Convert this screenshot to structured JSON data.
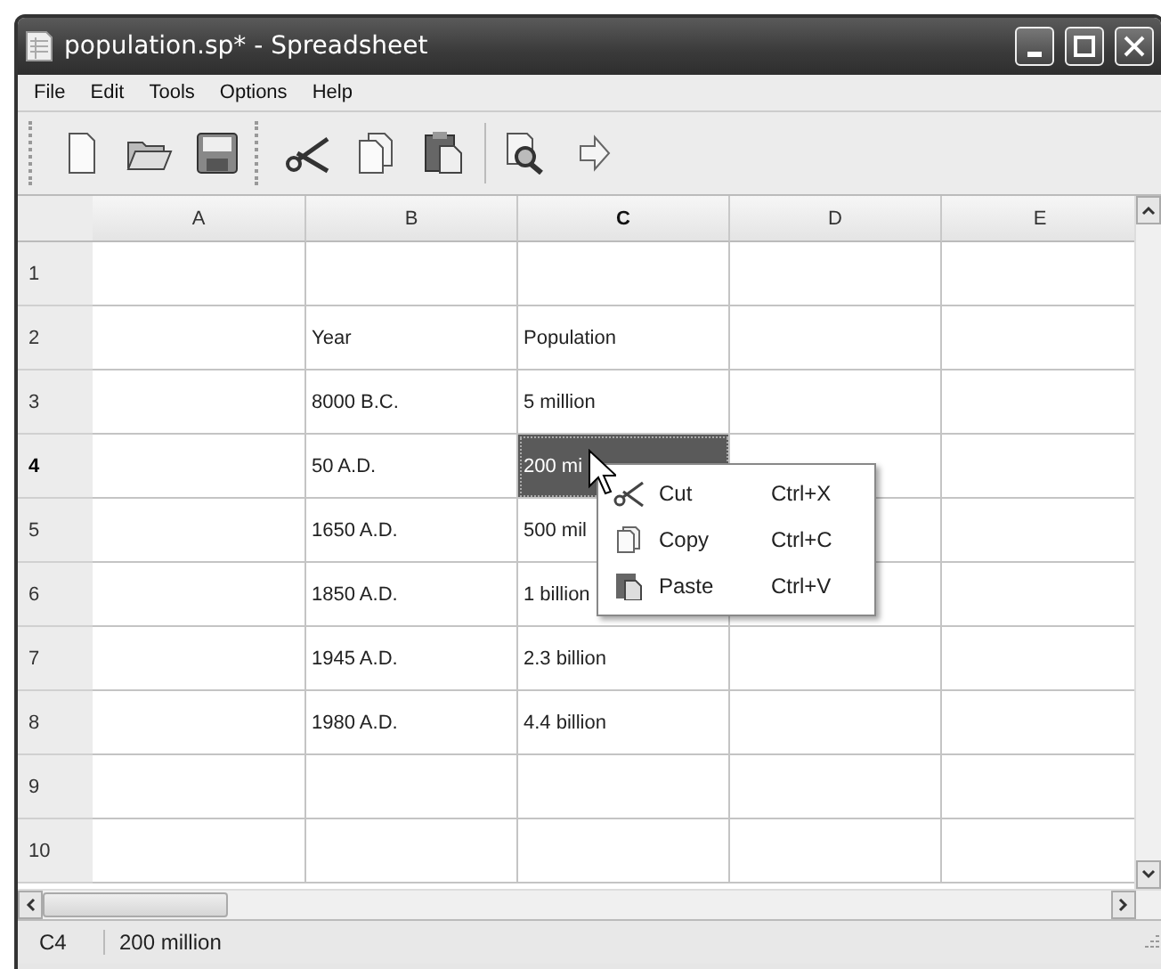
{
  "window": {
    "title": "population.sp* - Spreadsheet"
  },
  "menu_bar": [
    "File",
    "Edit",
    "Tools",
    "Options",
    "Help"
  ],
  "sheet": {
    "columns": [
      {
        "label": "A",
        "selected": false
      },
      {
        "label": "B",
        "selected": false
      },
      {
        "label": "C",
        "selected": true
      },
      {
        "label": "D",
        "selected": false
      },
      {
        "label": "E",
        "selected": false
      }
    ],
    "rows": [
      {
        "header": "1",
        "selected": false,
        "cells": [
          null,
          null,
          null,
          null,
          null
        ]
      },
      {
        "header": "2",
        "selected": false,
        "cells": [
          null,
          {
            "text": "Year",
            "selected": false
          },
          {
            "text": "Population",
            "selected": false
          },
          null,
          null
        ]
      },
      {
        "header": "3",
        "selected": false,
        "cells": [
          null,
          {
            "text": "8000 B.C.",
            "selected": false
          },
          {
            "text": "5 million",
            "selected": false
          },
          null,
          null
        ]
      },
      {
        "header": "4",
        "selected": true,
        "cells": [
          null,
          {
            "text": "50 A.D.",
            "selected": false
          },
          {
            "text": "200 mi",
            "selected": true
          },
          null,
          null
        ]
      },
      {
        "header": "5",
        "selected": false,
        "cells": [
          null,
          {
            "text": "1650 A.D.",
            "selected": false
          },
          {
            "text": "500 mil",
            "selected": false
          },
          null,
          null
        ]
      },
      {
        "header": "6",
        "selected": false,
        "cells": [
          null,
          {
            "text": "1850 A.D.",
            "selected": false
          },
          {
            "text": "1 billion",
            "selected": false
          },
          null,
          null
        ]
      },
      {
        "header": "7",
        "selected": false,
        "cells": [
          null,
          {
            "text": "1945 A.D.",
            "selected": false
          },
          {
            "text": "2.3 billion",
            "selected": false
          },
          null,
          null
        ]
      },
      {
        "header": "8",
        "selected": false,
        "cells": [
          null,
          {
            "text": "1980 A.D.",
            "selected": false
          },
          {
            "text": "4.4 billion",
            "selected": false
          },
          null,
          null
        ]
      },
      {
        "header": "9",
        "selected": false,
        "cells": [
          null,
          null,
          null,
          null,
          null
        ]
      },
      {
        "header": "10",
        "selected": false,
        "cells": [
          null,
          null,
          null,
          null,
          null
        ]
      }
    ]
  },
  "context_menu": [
    {
      "kind": "cut",
      "label": "Cut",
      "shortcut": "Ctrl+X"
    },
    {
      "kind": "copy",
      "label": "Copy",
      "shortcut": "Ctrl+C"
    },
    {
      "kind": "paste",
      "label": "Paste",
      "shortcut": "Ctrl+V"
    }
  ],
  "status_bar": {
    "cell": "C4",
    "value": "200 million"
  }
}
